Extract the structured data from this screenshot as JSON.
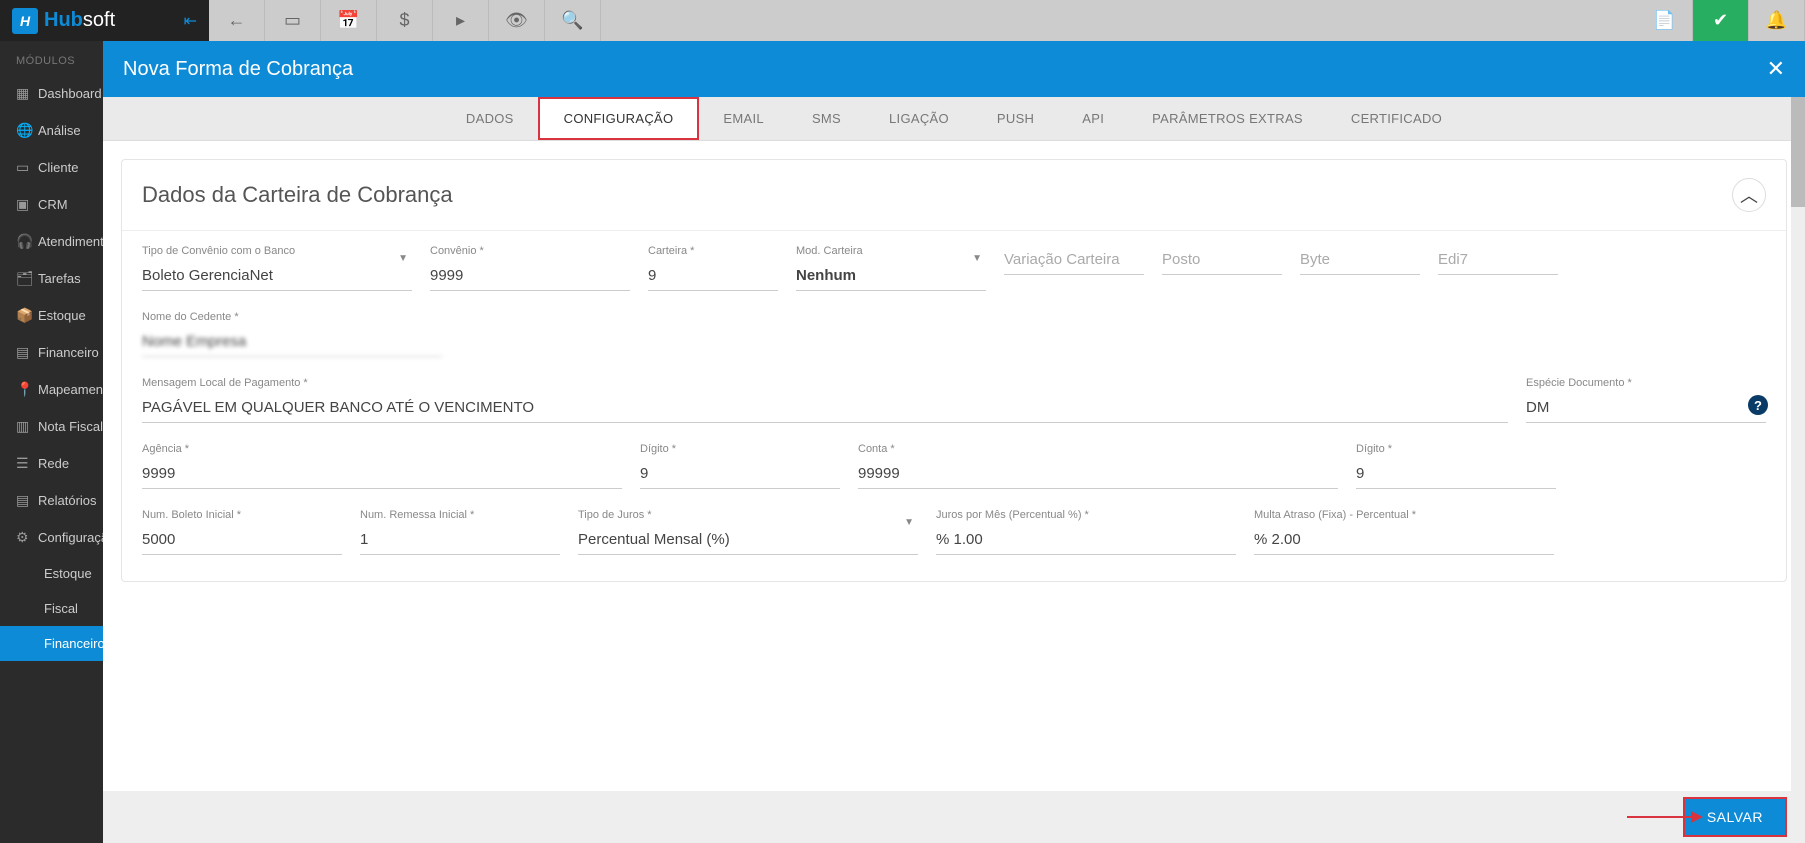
{
  "brand": {
    "name_a": "Hub",
    "name_b": "soft"
  },
  "sidebar": {
    "section": "MÓDULOS",
    "items": [
      {
        "label": "Dashboard"
      },
      {
        "label": "Análise"
      },
      {
        "label": "Cliente"
      },
      {
        "label": "CRM"
      },
      {
        "label": "Atendimento"
      },
      {
        "label": "Tarefas"
      },
      {
        "label": "Estoque"
      },
      {
        "label": "Financeiro"
      },
      {
        "label": "Mapeamento"
      },
      {
        "label": "Nota Fiscal"
      },
      {
        "label": "Rede"
      },
      {
        "label": "Relatórios"
      },
      {
        "label": "Configuração"
      }
    ],
    "subs": [
      {
        "label": "Estoque"
      },
      {
        "label": "Fiscal"
      },
      {
        "label": "Financeiro",
        "active": true
      }
    ]
  },
  "modal": {
    "title": "Nova Forma de Cobrança",
    "tabs": [
      "DADOS",
      "CONFIGURAÇÃO",
      "EMAIL",
      "SMS",
      "LIGAÇÃO",
      "PUSH",
      "API",
      "PARÂMETROS EXTRAS",
      "CERTIFICADO"
    ],
    "active_tab": "CONFIGURAÇÃO",
    "panel_title": "Dados da Carteira de Cobrança",
    "fields": {
      "tipo_convenio_label": "Tipo de Convênio com o Banco",
      "tipo_convenio_value": "Boleto GerenciaNet",
      "convenio_label": "Convênio *",
      "convenio_value": "9999",
      "carteira_label": "Carteira *",
      "carteira_value": "9",
      "mod_carteira_label": "Mod. Carteira",
      "mod_carteira_value": "Nenhum",
      "variacao_placeholder": "Variação Carteira",
      "posto_placeholder": "Posto",
      "byte_placeholder": "Byte",
      "edi7_placeholder": "Edi7",
      "nome_cedente_label": "Nome do Cedente *",
      "nome_cedente_value": "Nome Empresa",
      "msg_local_label": "Mensagem Local de Pagamento *",
      "msg_local_value": "PAGÁVEL EM QUALQUER BANCO ATÉ O VENCIMENTO",
      "especie_label": "Espécie Documento *",
      "especie_value": "DM",
      "agencia_label": "Agência *",
      "agencia_value": "9999",
      "digito1_label": "Dígito *",
      "digito1_value": "9",
      "conta_label": "Conta *",
      "conta_value": "99999",
      "digito2_label": "Dígito *",
      "digito2_value": "9",
      "num_boleto_label": "Num. Boleto Inicial *",
      "num_boleto_value": "5000",
      "num_remessa_label": "Num. Remessa Inicial *",
      "num_remessa_value": "1",
      "tipo_juros_label": "Tipo de Juros *",
      "tipo_juros_value": "Percentual Mensal (%)",
      "juros_mes_label": "Juros por Mês (Percentual %) *",
      "juros_mes_value": "% 1.00",
      "multa_label": "Multa Atraso (Fixa) - Percentual *",
      "multa_value": "% 2.00"
    },
    "save": "SALVAR"
  }
}
